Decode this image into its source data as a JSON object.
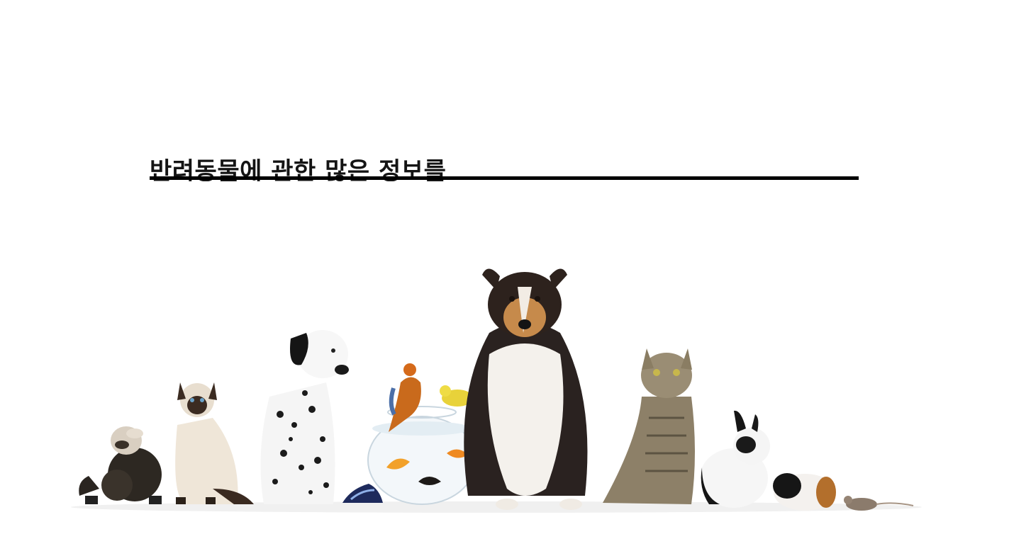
{
  "banner": {
    "headline": "반려동물에 관한 많은 정보를",
    "colors": {
      "background": "#ffffff",
      "headline": "#141414",
      "underline": "#000000"
    }
  },
  "illustration": {
    "animals": [
      "ferret",
      "siamese-cat",
      "dalmatian",
      "poison-dart-frog",
      "parrot",
      "canary",
      "goldfish-bowl",
      "collie",
      "tabby-cat",
      "rabbit",
      "guinea-pig",
      "mouse"
    ]
  }
}
